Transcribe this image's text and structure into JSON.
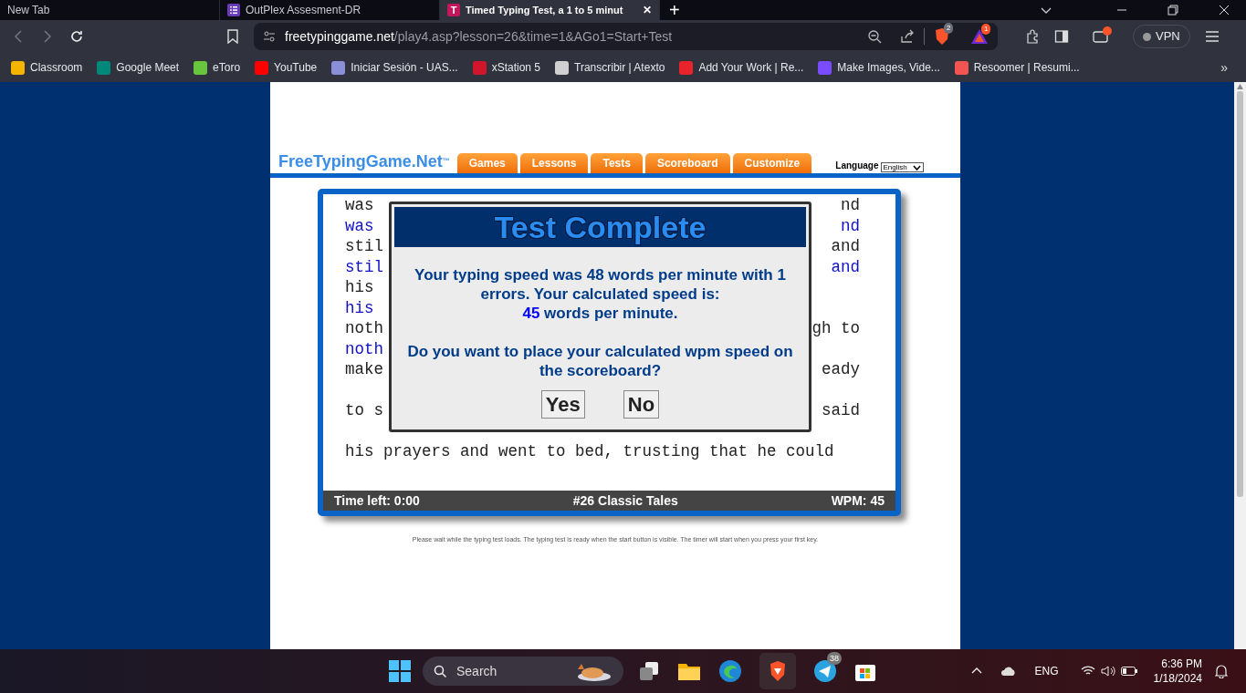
{
  "browser": {
    "tabs": [
      {
        "title": "New Tab",
        "selected": false
      },
      {
        "title": "OutPlex Assesment-DR",
        "selected": false
      },
      {
        "title": "Timed Typing Test, a 1 to 5 minut",
        "letter": "T",
        "close": "✕",
        "selected": true
      }
    ],
    "new_tab": "+",
    "more_bookmarks": "»",
    "address": {
      "domain": "freetypinggame.net",
      "path": "/play4.asp?lesson=26&time=1&AGo1=Start+Test"
    },
    "shield_badge": "2",
    "rewards_badge": "1",
    "vpn": "VPN",
    "bookmarks": [
      {
        "label": "Classroom",
        "color": "#f4b400"
      },
      {
        "label": "Google Meet",
        "color": "#00897b"
      },
      {
        "label": "eToro",
        "color": "#69c53e"
      },
      {
        "label": "YouTube",
        "color": "#ff0000"
      },
      {
        "label": "Iniciar Sesión - UAS...",
        "color": "#8a8fd8"
      },
      {
        "label": "xStation 5",
        "color": "#d1152c"
      },
      {
        "label": "Transcribir | Atexto",
        "color": "#d0d0d0"
      },
      {
        "label": "Add Your Work | Re...",
        "color": "#e8232a"
      },
      {
        "label": "Make Images, Vide...",
        "color": "#7a4cff"
      },
      {
        "label": "Resoomer | Resumi...",
        "color": "#f25454"
      }
    ]
  },
  "site": {
    "logo": "FreeTypingGame.Net",
    "logo_mark": "™",
    "nav": [
      "Games",
      "Lessons",
      "Tests",
      "Scoreboard",
      "Customize"
    ],
    "language_label": "Language",
    "language_value": "English",
    "typing_lines": [
      {
        "kind": "source",
        "left": "was",
        "right": "nd"
      },
      {
        "kind": "typed",
        "left": "was",
        "right": "nd"
      },
      {
        "kind": "source",
        "left": "stil",
        "right": "and"
      },
      {
        "kind": "typed",
        "left": "stil",
        "right": "and"
      },
      {
        "kind": "source",
        "left": "his"
      },
      {
        "kind": "typed",
        "left": "his"
      },
      {
        "kind": "source",
        "left": "noth",
        "right": "gh to"
      },
      {
        "kind": "typed",
        "left": "noth"
      },
      {
        "kind": "source",
        "left": "make",
        "right": "eady"
      },
      {
        "kind": "blank"
      },
      {
        "kind": "source",
        "left": "to s",
        "right": "said"
      },
      {
        "kind": "blank"
      },
      {
        "kind": "source",
        "left": "his prayers and went to bed, trusting that he could"
      }
    ],
    "status": {
      "time_left": "Time left: 0:00",
      "lesson": "#26 Classic Tales",
      "wpm": "WPM: 45"
    },
    "note": "Please wait while the typing test loads. The typing test is ready when the start button is visible. The timer will start when you press your first key.",
    "dialog": {
      "title": "Test Complete",
      "message": "Your typing speed was 48 words per minute with 1 errors. Your calculated speed is:",
      "speed": "45",
      "speed_suffix": "words per minute.",
      "question": "Do you want to place your calculated wpm speed on the scoreboard?",
      "buttons": [
        "Yes",
        "No"
      ]
    }
  },
  "taskbar": {
    "search_placeholder": "Search",
    "telegram_badge": "38",
    "language": "ENG",
    "time": "6:36 PM",
    "date": "1/18/2024"
  }
}
